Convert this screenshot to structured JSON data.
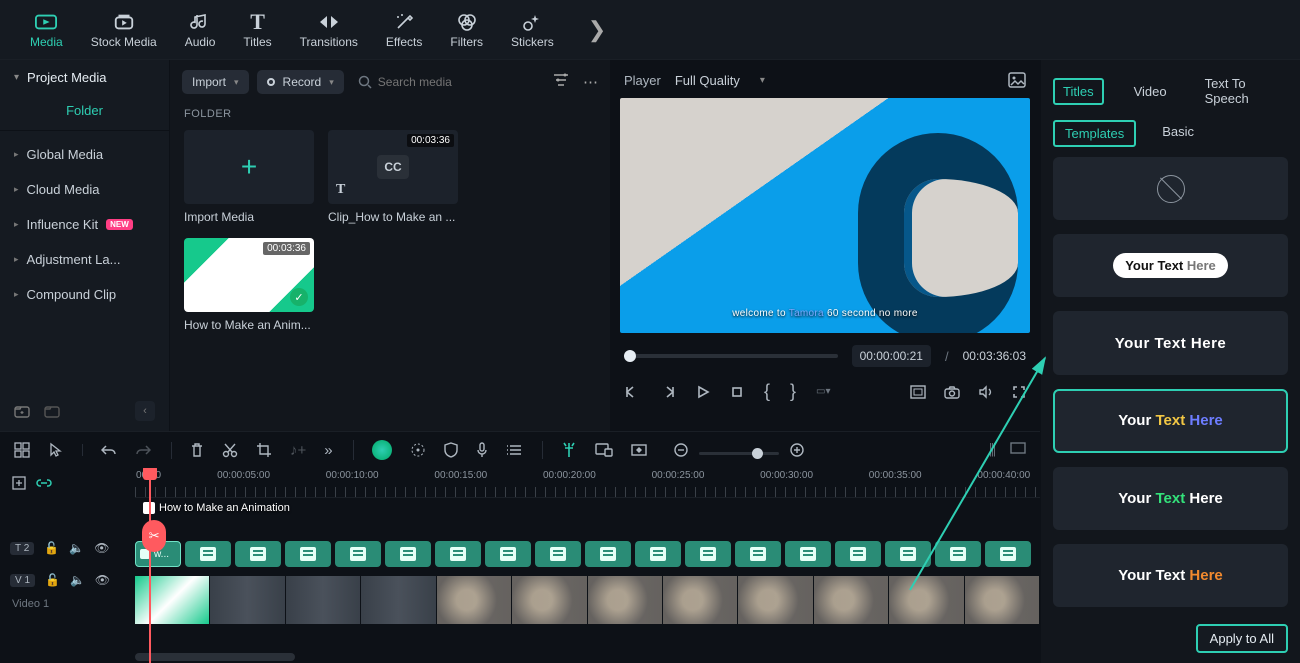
{
  "topnav": {
    "items": [
      {
        "label": "Media"
      },
      {
        "label": "Stock Media"
      },
      {
        "label": "Audio"
      },
      {
        "label": "Titles"
      },
      {
        "label": "Transitions"
      },
      {
        "label": "Effects"
      },
      {
        "label": "Filters"
      },
      {
        "label": "Stickers"
      }
    ]
  },
  "sidebar": {
    "project_media": "Project Media",
    "folder": "Folder",
    "items": [
      {
        "label": "Global Media"
      },
      {
        "label": "Cloud Media"
      },
      {
        "label": "Influence Kit",
        "badge": "NEW"
      },
      {
        "label": "Adjustment La..."
      },
      {
        "label": "Compound Clip"
      }
    ]
  },
  "library": {
    "import": "Import",
    "record": "Record",
    "search_placeholder": "Search media",
    "section": "FOLDER",
    "tiles": [
      {
        "caption": "Import Media",
        "kind": "import"
      },
      {
        "caption": "Clip_How to Make an ...",
        "kind": "cc",
        "duration": "00:03:36"
      },
      {
        "caption": "How to Make an Anim...",
        "kind": "howto",
        "duration": "00:03:36"
      }
    ]
  },
  "player": {
    "label": "Player",
    "quality": "Full Quality",
    "caption_pre": "welcome to ",
    "caption_brand": "Tamora",
    "caption_post": " 60 second no more",
    "current": "00:00:00:21",
    "sep": "/",
    "duration": "00:03:36:03"
  },
  "right": {
    "tabs": [
      "Titles",
      "Video",
      "Text To Speech"
    ],
    "subtabs": [
      "Templates",
      "Basic"
    ],
    "template_text": {
      "your": "Your",
      "text": "Text",
      "here": "Here"
    },
    "apply_all": "Apply to All"
  },
  "timeline": {
    "ruler": [
      "00:00",
      "00:00:05:00",
      "00:00:10:00",
      "00:00:15:00",
      "00:00:20:00",
      "00:00:25:00",
      "00:00:30:00",
      "00:00:35:00",
      "00:00:40:00"
    ],
    "title_track": {
      "name": "T",
      "count": "2",
      "first_clip": "w..."
    },
    "video_track": {
      "name": "V",
      "count": "1",
      "label": "Video 1",
      "clip_label": "How to Make an Animation"
    }
  }
}
